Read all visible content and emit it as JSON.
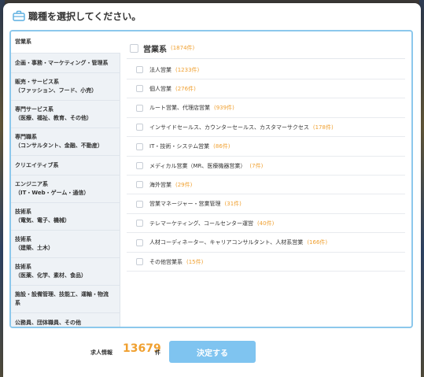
{
  "modal": {
    "title": "職種を選択してください。",
    "icon": "briefcase-icon"
  },
  "sidebar": {
    "items": [
      {
        "lines": [
          "営業系"
        ],
        "active": true
      },
      {
        "lines": [
          "企画・事務・マーケティング・管理系"
        ]
      },
      {
        "lines": [
          "販売・サービス系",
          "（ファッション、フード、小売）"
        ]
      },
      {
        "lines": [
          "専門サービス系",
          "（医療、福祉、教育、その他）"
        ]
      },
      {
        "lines": [
          "専門職系",
          "（コンサルタント、金融、不動産）"
        ]
      },
      {
        "lines": [
          "クリエイティブ系"
        ]
      },
      {
        "lines": [
          "エンジニア系",
          "（IT・Web・ゲーム・通信）"
        ]
      },
      {
        "lines": [
          "技術系",
          "（電気、電子、機械）"
        ]
      },
      {
        "lines": [
          "技術系",
          "（建築、土木）"
        ]
      },
      {
        "lines": [
          "技術系",
          "（医薬、化学、素材、食品）"
        ]
      },
      {
        "lines": [
          "施設・設備管理、技能工、運輸・物流",
          "系"
        ]
      },
      {
        "lines": [
          "公務員、団体職員、その他"
        ]
      }
    ]
  },
  "category": {
    "title": "営業系",
    "count": "(1874件)"
  },
  "jobs": [
    {
      "label": "法人営業",
      "count": "(1233件)"
    },
    {
      "label": "個人営業",
      "count": "(276件)"
    },
    {
      "label": "ルート営業、代理店営業",
      "count": "(939件)"
    },
    {
      "label": "インサイドセールス、カウンターセールス、カスタマーサクセス",
      "count": "(178件)"
    },
    {
      "label": "IT・技術・システム営業",
      "count": "(86件)"
    },
    {
      "label": "メディカル営業（MR、医療機器営業）",
      "count": "(7件)"
    },
    {
      "label": "海外営業",
      "count": "(29件)"
    },
    {
      "label": "営業マネージャー・営業管理",
      "count": "(31件)"
    },
    {
      "label": "テレマーケティング、コールセンター運営",
      "count": "(40件)"
    },
    {
      "label": "人材コーディネーター、キャリアコンサルタント、人材系営業",
      "count": "(166件)"
    },
    {
      "label": "その他営業系",
      "count": "(15件)"
    }
  ],
  "footer": {
    "jobs_label": "求人情報",
    "jobs_count": "13679",
    "jobs_unit": "件",
    "decide_label": "決定する"
  },
  "colors": {
    "accent": "#7fc4f0",
    "count": "#f0a030",
    "panel_border": "#8cc8ec",
    "sidebar_bg": "#eef2f6"
  }
}
